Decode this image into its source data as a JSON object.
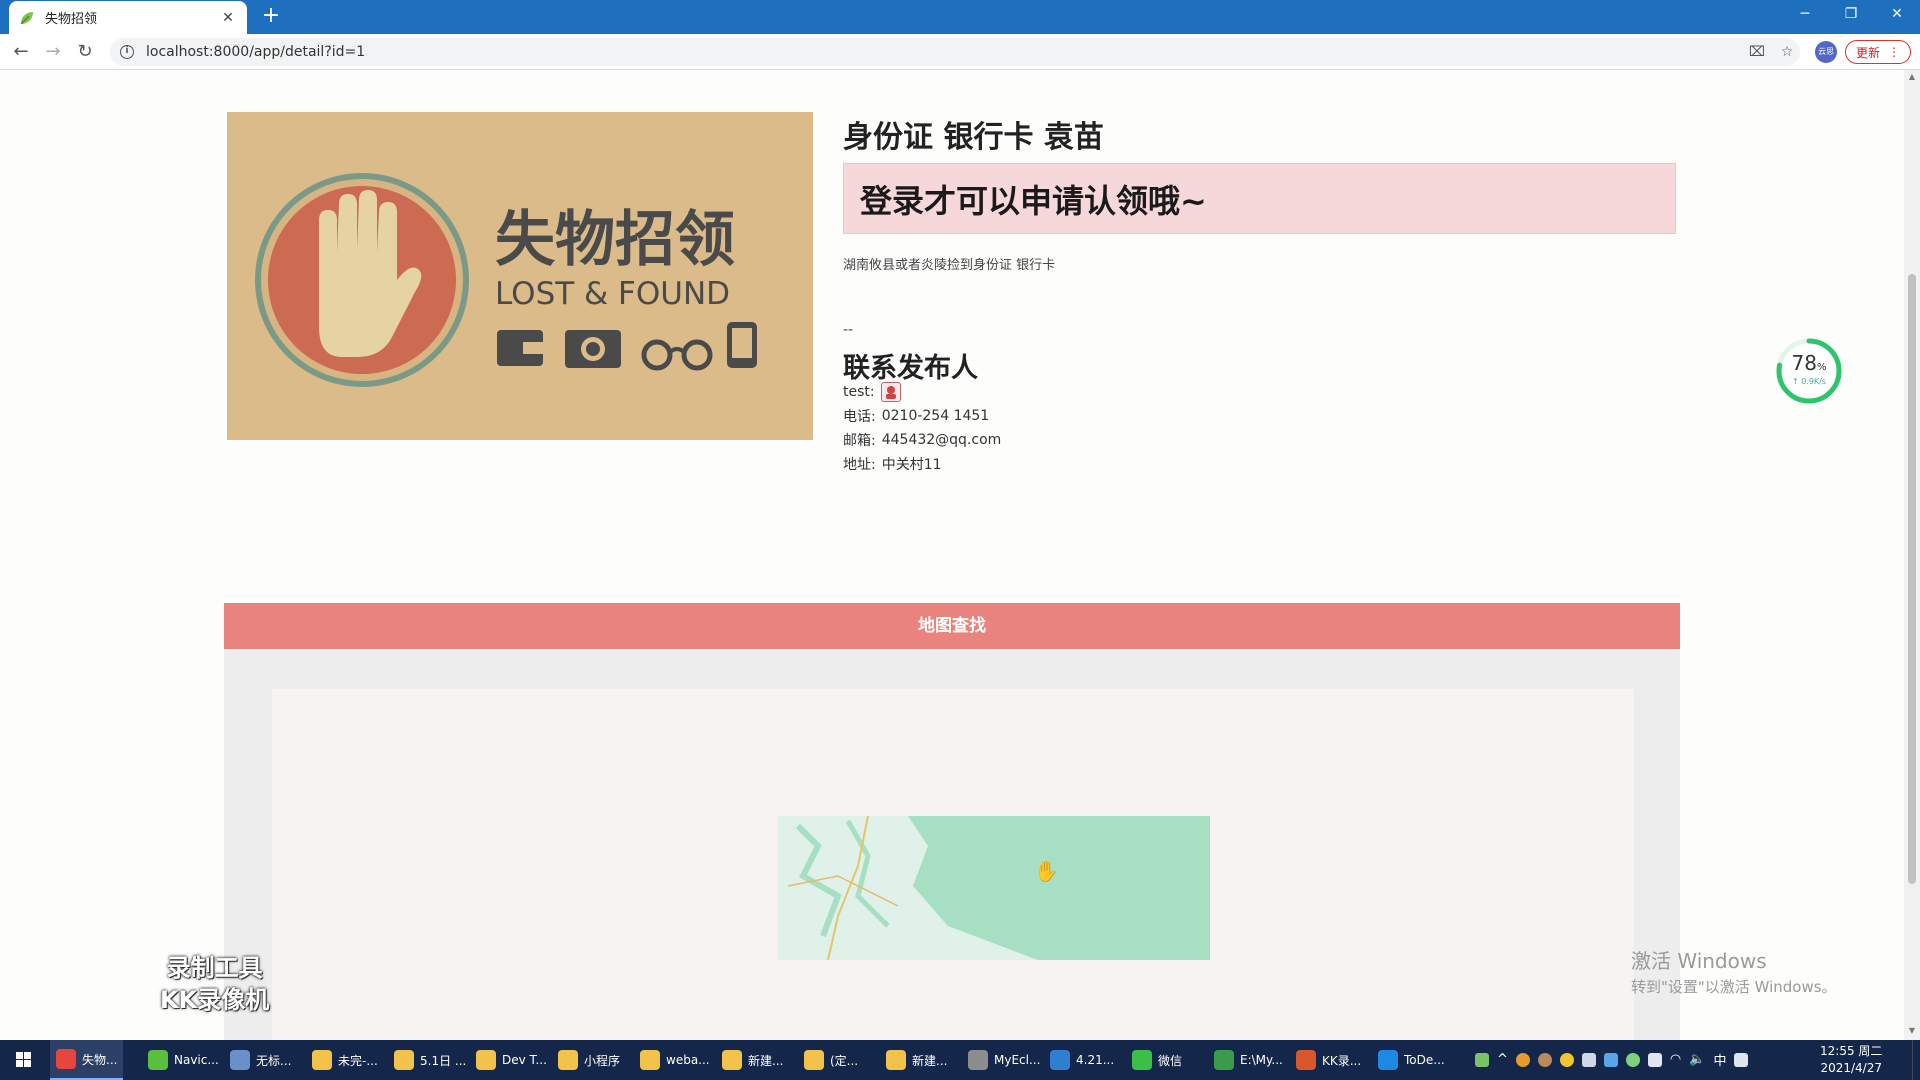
{
  "browser": {
    "tab_title": "失物招领",
    "tab_close": "✕",
    "new_tab": "+",
    "url": "localhost:8000/app/detail?id=1",
    "update_label": "更新",
    "profile_initial": "云思"
  },
  "item": {
    "title": "身份证 银行卡 袁苗",
    "login_notice": "登录才可以申请认领哦~",
    "description": "湖南攸县或者炎陵捡到身份证 银行卡",
    "separator": "--",
    "image_text": {
      "cn": "失物招领",
      "en": "LOST & FOUND"
    }
  },
  "contact": {
    "title": "联系发布人",
    "user_label": "test:",
    "phone_label": "电话:",
    "phone": "0210-254 1451",
    "email_label": "邮箱:",
    "email": "445432@qq.com",
    "address_label": "地址:",
    "address": "中关村11"
  },
  "map": {
    "header": "地图查找"
  },
  "speed_widget": {
    "percent": "78",
    "percent_unit": "%",
    "rate": "↑ 0.9K/s",
    "level": 0.78
  },
  "overlay": {
    "recorder_line1": "录制工具",
    "recorder_line2": "KK录像机",
    "activate_line1": "激活 Windows",
    "activate_line2": "转到\"设置\"以激活 Windows。"
  },
  "taskbar": {
    "items": [
      {
        "label": "失物...",
        "icon": "chrome-icon",
        "color": "#e8453c"
      },
      {
        "label": "Navic...",
        "icon": "navicat-icon",
        "color": "#5bbf3e"
      },
      {
        "label": "无标...",
        "icon": "paint-icon",
        "color": "#6a8fc9"
      },
      {
        "label": "未完-...",
        "icon": "folder-icon",
        "color": "#f3c24a"
      },
      {
        "label": "5.1日 ...",
        "icon": "folder-icon",
        "color": "#f3c24a"
      },
      {
        "label": "Dev T...",
        "icon": "folder-icon",
        "color": "#f3c24a"
      },
      {
        "label": "小程序",
        "icon": "folder-icon",
        "color": "#f3c24a"
      },
      {
        "label": "weba...",
        "icon": "folder-icon",
        "color": "#f3c24a"
      },
      {
        "label": "新建...",
        "icon": "folder-icon",
        "color": "#f3c24a"
      },
      {
        "label": "(定...",
        "icon": "folder-icon",
        "color": "#f3c24a"
      },
      {
        "label": "新建...",
        "icon": "folder-icon",
        "color": "#f3c24a"
      },
      {
        "label": "MyEcl...",
        "icon": "myeclipse-icon",
        "color": "#8d8d8d"
      },
      {
        "label": "4.21...",
        "icon": "vscode-icon",
        "color": "#2f7fd0"
      },
      {
        "label": "微信",
        "icon": "wechat-icon",
        "color": "#3cbf49"
      },
      {
        "label": "E:\\My...",
        "icon": "editor-icon",
        "color": "#3b9b4b"
      },
      {
        "label": "KK录...",
        "icon": "kk-icon",
        "color": "#d9572b"
      },
      {
        "label": "ToDe...",
        "icon": "todesk-icon",
        "color": "#1e88e5"
      }
    ],
    "ime": "中",
    "time": "12:55 周二",
    "date": "2021/4/27"
  },
  "colors": {
    "tabbar": "#1f6fbf",
    "alert_bg": "#f6d7da",
    "map_header": "#e8837d",
    "map_tile": "#a7dfc2",
    "taskbar": "#14264a"
  }
}
